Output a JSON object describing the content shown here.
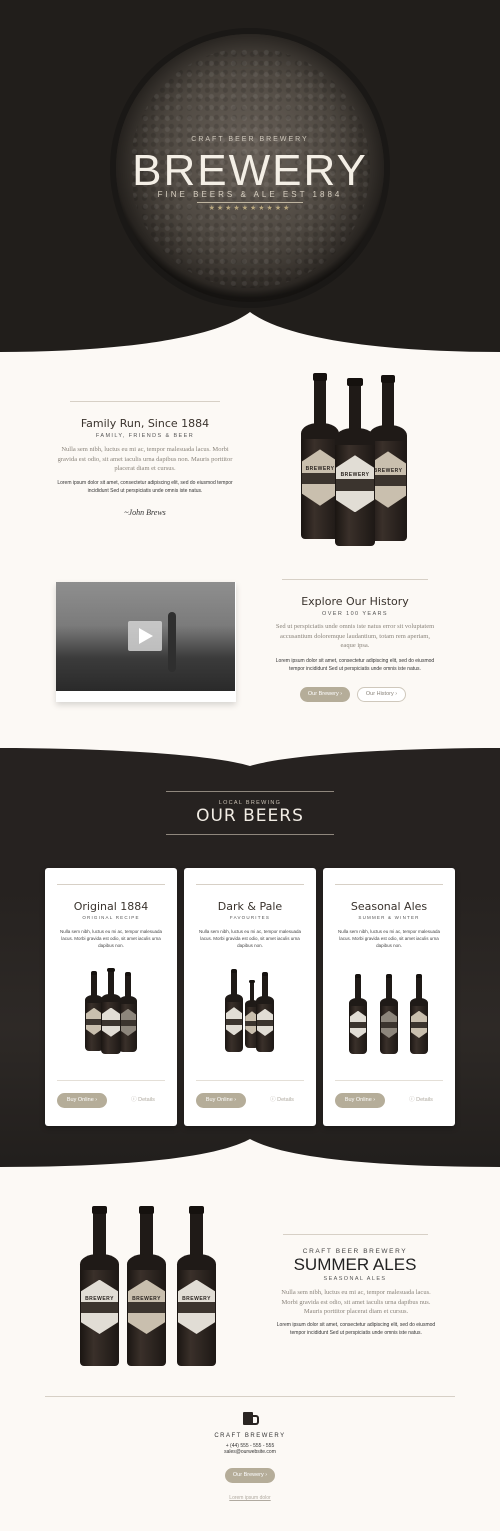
{
  "hero": {
    "eyebrow": "CRAFT BEER BREWERY",
    "title": "BREWERY",
    "subtitle": "FINE BEERS & ALE EST 1884",
    "stars": "★★★★★★★★★★"
  },
  "family": {
    "title": "Family Run, Since 1884",
    "eyebrow": "FAMILY, FRIENDS & BEER",
    "body_serif": "Nulla sem nibh, luctus eu mi ac, tempor malesuada lacus. Morbi gravida est odio, sit amet iaculis urna dapibus non. Mauris porttitor placerat diam et cursus.",
    "body_sans": "Lorem ipsum dolor sit amet, consectetur adipiscing elit, sed do eiusmod tempor incididunt Sed ut perspiciatis unde omnis iste natus.",
    "signature": "~John Brews"
  },
  "history": {
    "title": "Explore Our History",
    "eyebrow": "OVER 100 YEARS",
    "body_serif": "Sed ut perspiciatis unde omnis iste natus error sit voluptatem accusantium doloremque laudantium, totam rem aperiam, eaque ipsa.",
    "body_sans": "Lorem ipsum dolor sit amet, consectetur adipiscing elit, sed do eiusmod tempor incididunt Sed ut perspiciatis unde omnis iste natus.",
    "btn_primary": "Our Brewery",
    "btn_secondary": "Our History",
    "chevron": "›"
  },
  "beers": {
    "eyebrow": "LOCAL BREWING",
    "title": "OUR BEERS",
    "cards": [
      {
        "title": "Original 1884",
        "sub": "ORIGINAL RECIPE",
        "body": "Nulla sem nibh, luctus eu mi ac, tempor malesuada lacus. Morbi gravida est odio, sit amet iaculis urna dapibus non.",
        "buy": "Buy Online",
        "details": "Details"
      },
      {
        "title": "Dark & Pale",
        "sub": "FAVOURITES",
        "body": "Nulla sem nibh, luctus eu mi ac, tempor malesuada lacus. Morbi gravida est odio, sit amet iaculis urna dapibus non.",
        "buy": "Buy Online",
        "details": "Details"
      },
      {
        "title": "Seasonal Ales",
        "sub": "SUMMER & WINTER",
        "body": "Nulla sem nibh, luctus eu mi ac, tempor malesuada lacus. Morbi gravida est odio, sit amet iaculis urna dapibus non.",
        "buy": "Buy Online",
        "details": "Details"
      }
    ]
  },
  "summer": {
    "eyebrow": "CRAFT BEER BREWERY",
    "title": "SUMMER ALES",
    "sub": "SEASONAL ALES",
    "body_serif": "Nulla sem nibh, luctus eu mi ac, tempor malesuada lacus. Morbi gravida est odio, sit amet iaculis urna dapibus nus. Mauris porttitor placerat diam et cursus.",
    "body_sans": "Lorem ipsum dolor sit amet, consectetur adipiscing elit, sed do eiusmod tempor incididunt Sed ut perspiciatis unde omnis iste natus."
  },
  "footer": {
    "brand": "CRAFT BREWERY",
    "phone": "+ (44) 555 - 555 - 555",
    "email": "sales@ourwebsite.com",
    "button": "Our Brewery",
    "link": "Lorem ipsum dolor"
  },
  "bottle_word": "BREWERY",
  "colors": {
    "dark": "#211e1b",
    "cream": "#fcf9f5",
    "accent": "#b5ad99",
    "gold": "#b8a77e"
  }
}
